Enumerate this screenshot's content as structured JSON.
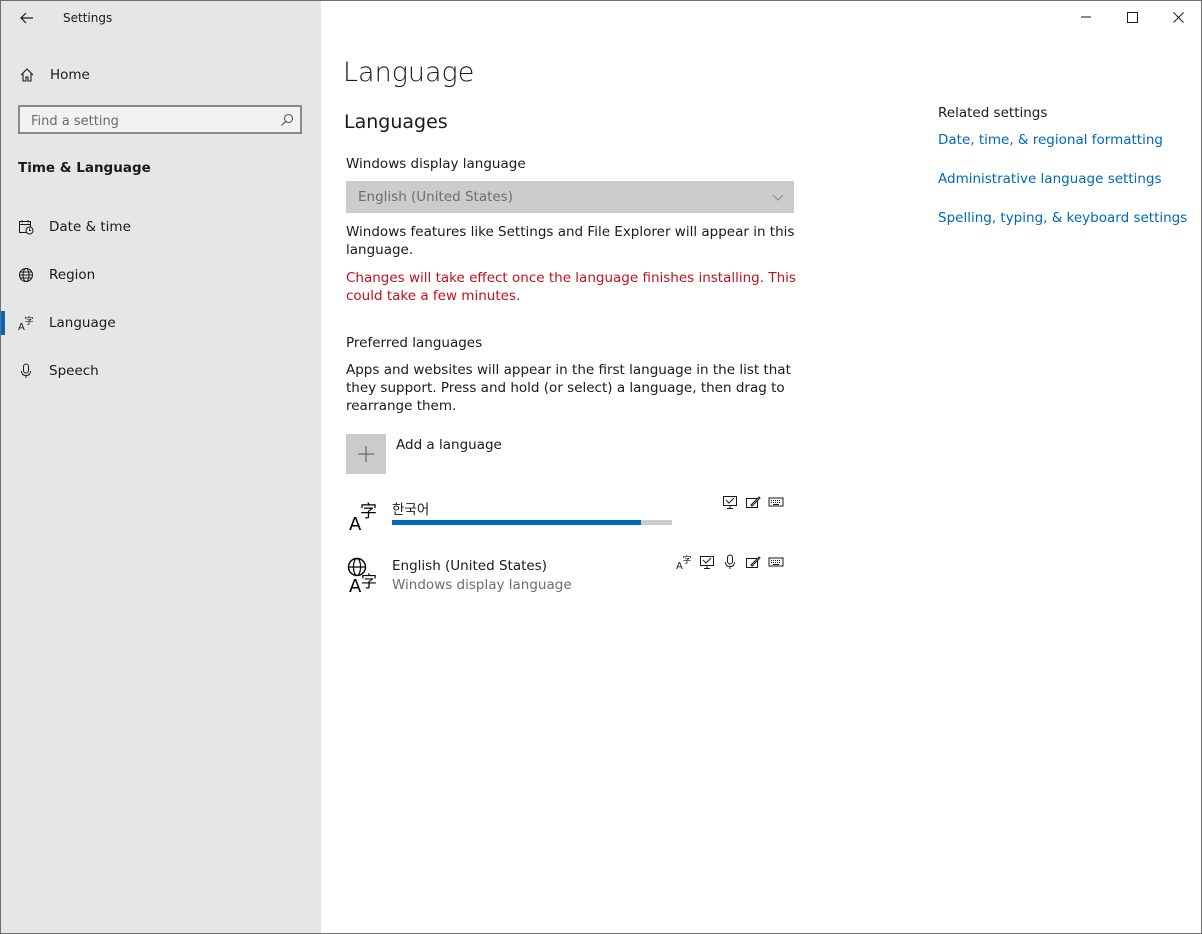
{
  "window": {
    "app_title": "Settings",
    "controls": [
      "minimize",
      "maximize",
      "close"
    ]
  },
  "sidebar": {
    "home_label": "Home",
    "search_placeholder": "Find a setting",
    "section_title": "Time & Language",
    "items": [
      {
        "label": "Date & time",
        "icon": "clock-calendar-icon",
        "active": false
      },
      {
        "label": "Region",
        "icon": "globe-icon",
        "active": false
      },
      {
        "label": "Language",
        "icon": "language-icon",
        "active": true
      },
      {
        "label": "Speech",
        "icon": "microphone-icon",
        "active": false
      }
    ]
  },
  "main": {
    "title": "Language",
    "languages_heading": "Languages",
    "display_language_label": "Windows display language",
    "display_language_value": "English (United States)",
    "display_language_note": "Windows features like Settings and File Explorer will appear in this language.",
    "warning": "Changes will take effect once the language finishes installing. This could take a few minutes.",
    "preferred_label": "Preferred languages",
    "preferred_note": "Apps and websites will appear in the first language in the list that they support. Press and hold (or select) a language, then drag to rearrange them.",
    "add_language_label": "Add a language",
    "languages": [
      {
        "name": "한국어",
        "subtitle": "",
        "install_progress": 0.89,
        "features": [
          "display-language-icon",
          "handwriting-icon",
          "keyboard-icon"
        ]
      },
      {
        "name": "English (United States)",
        "subtitle": "Windows display language",
        "features": [
          "language-pack-icon",
          "display-language-icon",
          "speech-icon",
          "handwriting-icon",
          "keyboard-icon"
        ]
      }
    ]
  },
  "related": {
    "title": "Related settings",
    "links": [
      "Date, time, & regional formatting",
      "Administrative language settings",
      "Spelling, typing, & keyboard settings"
    ]
  },
  "colors": {
    "accent": "#0067c0",
    "warning": "#c50f1f",
    "sidebar_bg": "#e6e6e6"
  }
}
